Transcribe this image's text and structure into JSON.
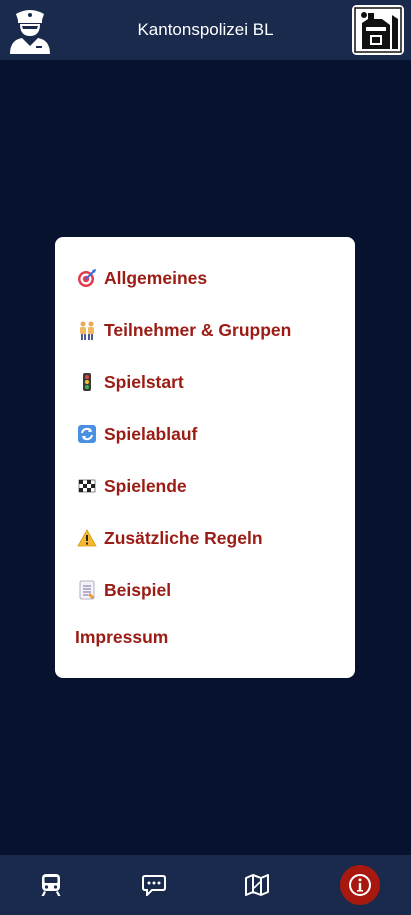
{
  "header": {
    "title": "Kantonspolizei BL"
  },
  "menu": {
    "items": [
      {
        "icon": "target-icon",
        "label": "Allgemeines"
      },
      {
        "icon": "people-icon",
        "label": "Teilnehmer & Gruppen"
      },
      {
        "icon": "traffic-light-icon",
        "label": "Spielstart"
      },
      {
        "icon": "cycle-arrows-icon",
        "label": "Spielablauf"
      },
      {
        "icon": "checkered-flag-icon",
        "label": "Spielende"
      },
      {
        "icon": "warning-icon",
        "label": "Zusätzliche Regeln"
      },
      {
        "icon": "document-icon",
        "label": "Beispiel"
      }
    ],
    "impressum": "Impressum"
  },
  "bottom_nav": {
    "items": [
      {
        "icon": "train-icon",
        "active": false
      },
      {
        "icon": "chat-icon",
        "active": false
      },
      {
        "icon": "map-icon",
        "active": false
      },
      {
        "icon": "info-icon",
        "active": true
      }
    ]
  },
  "colors": {
    "background": "#06122e",
    "bar": "#1a2a4d",
    "accent": "#a8180f",
    "menu_text": "#9a1c14"
  }
}
